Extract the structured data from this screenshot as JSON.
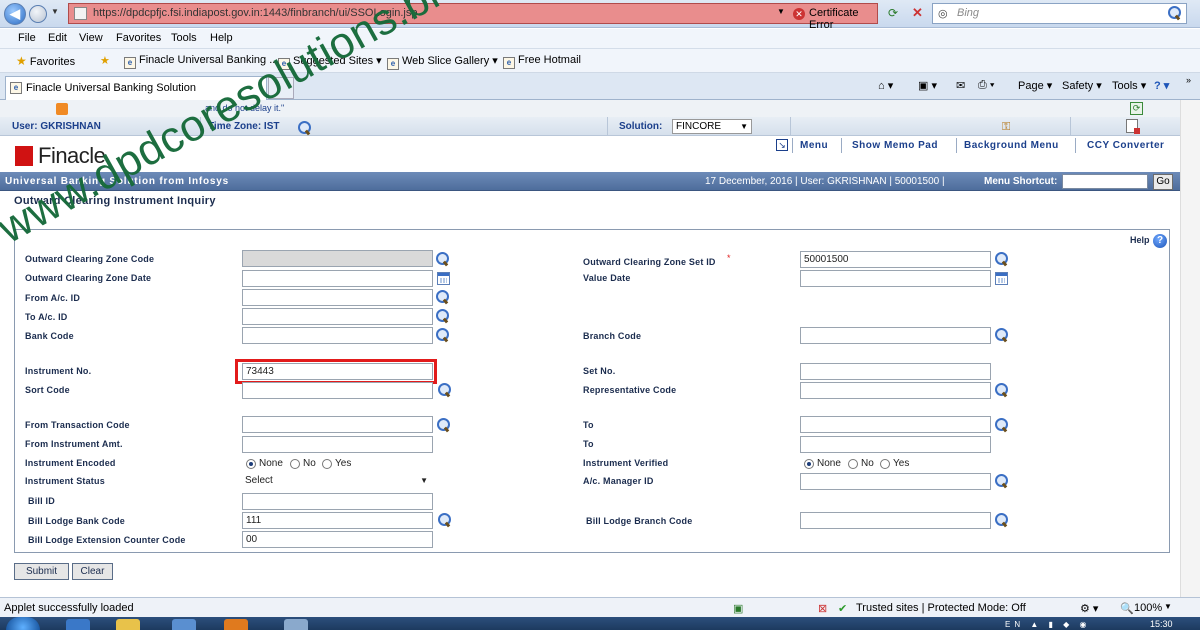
{
  "browser": {
    "url": "https://dpdcpfjc.fsi.indiapost.gov.in:1443/finbranch/ui/SSOLogin.jsp",
    "cert_error": "Certificate Error",
    "search_placeholder": "Bing",
    "menu": [
      "File",
      "Edit",
      "View",
      "Favorites",
      "Tools",
      "Help"
    ],
    "favorites_label": "Favorites",
    "fav_items": [
      "Finacle Universal Banking ...",
      "Suggested Sites ▾",
      "Web Slice Gallery ▾",
      "Free Hotmail"
    ],
    "tab_title": "Finacle Universal Banking Solution",
    "cmd_items": [
      "Page ▾",
      "Safety ▾",
      "Tools ▾"
    ],
    "status_text": "Applet successfully loaded",
    "zone_text": "Trusted sites | Protected Mode: Off",
    "zoom": "100%",
    "clock": "15:30",
    "tray_lang": "EN"
  },
  "finacle": {
    "ticker": "and do not delay it.\"",
    "user_label": "User: GKRISHNAN",
    "timezone_label": "Time Zone: IST",
    "solution_label": "Solution:",
    "solution_value": "FINCORE",
    "logo_text": "Finacle",
    "menu_links": [
      "Menu",
      "Show Memo Pad",
      "Background Menu",
      "CCY Converter"
    ],
    "tagline": "Universal Banking Solution from Infosys",
    "info_line": "17 December, 2016 | User: GKRISHNAN | 50001500 |",
    "menu_shortcut_label": "Menu Shortcut:",
    "go_label": "Go",
    "page_title": "Outward Clearing Instrument Inquiry",
    "help_label": "Help"
  },
  "form": {
    "outward_zone_code": {
      "label": "Outward Clearing Zone Code",
      "value": ""
    },
    "outward_zone_set_id": {
      "label": "Outward Clearing Zone Set ID",
      "value": "50001500",
      "required_mark": "*"
    },
    "outward_zone_date": {
      "label": "Outward Clearing Zone Date",
      "value": ""
    },
    "value_date": {
      "label": "Value Date",
      "value": ""
    },
    "from_acid": {
      "label": "From A/c. ID",
      "value": ""
    },
    "to_acid": {
      "label": "To A/c. ID",
      "value": ""
    },
    "bank_code": {
      "label": "Bank Code",
      "value": ""
    },
    "branch_code": {
      "label": "Branch Code",
      "value": ""
    },
    "instrument_no": {
      "label": "Instrument No.",
      "value": "73443"
    },
    "set_no": {
      "label": "Set No.",
      "value": ""
    },
    "sort_code": {
      "label": "Sort Code",
      "value": ""
    },
    "representative_code": {
      "label": "Representative Code",
      "value": ""
    },
    "from_tran_code": {
      "label": "From Transaction Code",
      "value": ""
    },
    "to_tran_code": {
      "label": "To",
      "value": ""
    },
    "from_instr_amt": {
      "label": "From Instrument Amt.",
      "value": ""
    },
    "to_instr_amt": {
      "label": "To",
      "value": ""
    },
    "instrument_encoded": {
      "label": "Instrument Encoded",
      "options": [
        "None",
        "No",
        "Yes"
      ],
      "selected": "None"
    },
    "instrument_verified": {
      "label": "Instrument Verified",
      "options": [
        "None",
        "No",
        "Yes"
      ],
      "selected": "None"
    },
    "instrument_status": {
      "label": "Instrument Status",
      "value": "Select"
    },
    "ac_manager_id": {
      "label": "A/c. Manager ID",
      "value": ""
    },
    "bill_id": {
      "label": "Bill ID",
      "value": ""
    },
    "bill_lodge_bank_code": {
      "label": "Bill Lodge Bank Code",
      "value": "111"
    },
    "bill_lodge_branch_code": {
      "label": "Bill Lodge Branch Code",
      "value": ""
    },
    "bill_lodge_ext_counter": {
      "label": "Bill Lodge Extension Counter Code",
      "value": "00"
    },
    "submit_label": "Submit",
    "clear_label": "Clear"
  },
  "watermark": "www.dpdcoresolutions.blogspot.com",
  "colors": {
    "url_bar_error": "#e98d8d",
    "header_blue": "#4e6d9c",
    "highlight_box": "#e21b1b",
    "watermark": "#166a3a"
  }
}
